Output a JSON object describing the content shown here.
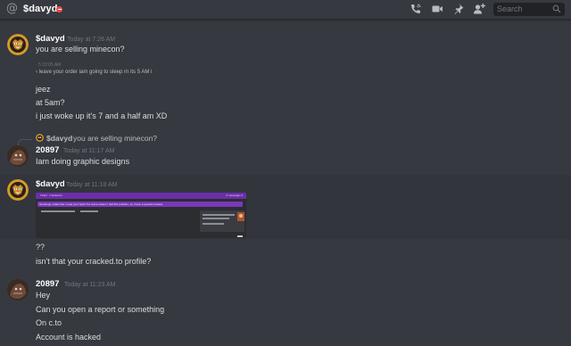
{
  "header": {
    "channel_name": "$davyd",
    "status_color": "#f04747",
    "icons": [
      "at-icon",
      "phone-call-icon",
      "video-call-icon",
      "pin-icon",
      "add-member-icon",
      "search-icon"
    ],
    "search_placeholder": "Search"
  },
  "messages": [
    {
      "username": "$davyd",
      "timestamp": "Today at 7:26 AM",
      "lines": [
        "you are selling minecon?"
      ]
    },
    {
      "tiny_timestamp": "· 5:22:05 AM",
      "tiny_text": "‹ leave your order iam going to sleep rn its 5 AM i"
    },
    {
      "lines": [
        "jeez",
        "at 5am?",
        "i just woke up it's 7 and a half am XD"
      ]
    },
    {
      "reply": {
        "username": "$davyd",
        "text": "you are selling minecon?"
      },
      "username": "20897",
      "timestamp": "Today at 11:17 AM",
      "lines": [
        "Iam doing graphic designs"
      ]
    },
    {
      "username": "$davyd",
      "timestamp": "Today at 11:18 AM",
      "attachment": {
        "bar_title": "Ticket · Cracked.to",
        "bar_right": "5 messages ▾",
        "message_text": "Greetings, whats this I need your help? For some reason i had this problem, so I have a question please",
        "accent_color": "#6b2fa8"
      },
      "after_lines": [
        "??",
        "isn't that your cracked.to profile?"
      ]
    },
    {
      "username": "20897",
      "timestamp": "Today at 11:23 AM",
      "lines": [
        "Hey",
        "Can you open a report or something",
        "On c.to",
        "Account is hacked"
      ]
    }
  ]
}
